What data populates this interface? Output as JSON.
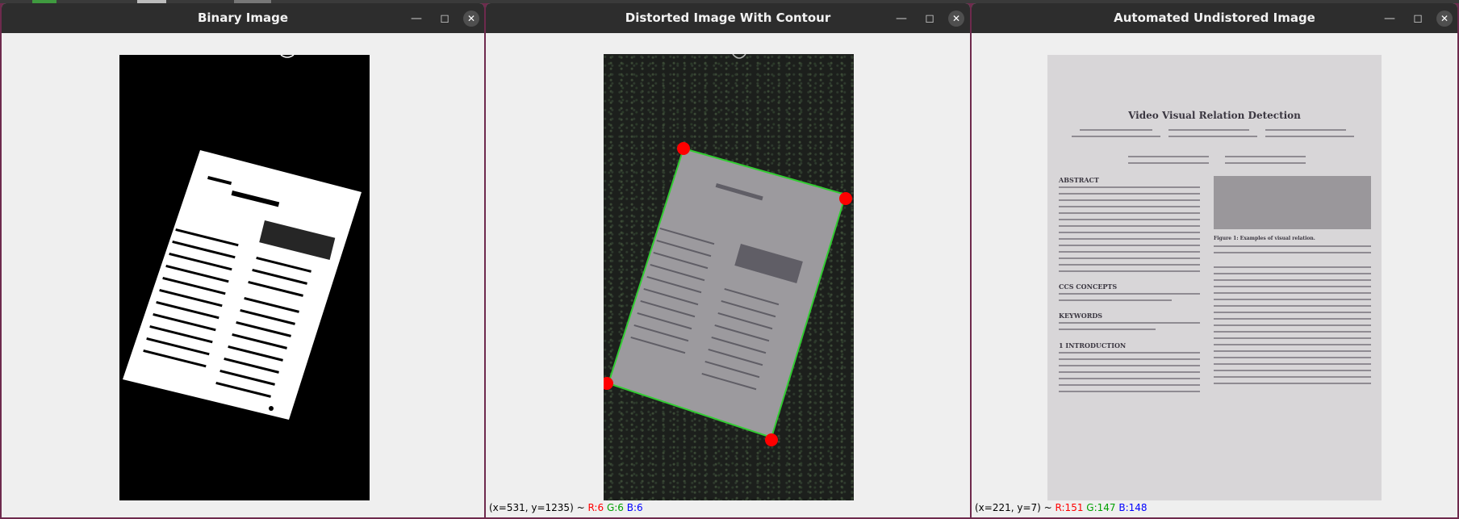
{
  "colors": {
    "desktop": "#6e2a4d",
    "titlebar": "#2d2d2d",
    "window_bg": "#efefef",
    "contour": "#33cc33",
    "corner": "#ff0000",
    "status_r": "#ff0000",
    "status_g": "#00a000",
    "status_b": "#0000ff"
  },
  "icons": [
    "minimize-icon",
    "maximize-icon",
    "close-icon"
  ],
  "windows": [
    {
      "title": "Binary Image",
      "status": null
    },
    {
      "title": "Distorted Image With Contour",
      "status": {
        "coords": "(x=531, y=1235) ~",
        "r": "R:6",
        "g": "G:6",
        "b": "B:6"
      }
    },
    {
      "title": "Automated Undistored Image",
      "status": {
        "coords": "(x=221, y=7) ~",
        "r": "R:151",
        "g": "G:147",
        "b": "B:148"
      }
    }
  ],
  "document": {
    "title": "Video Visual Relation Detection",
    "abstract_heading": "ABSTRACT",
    "ccs_heading": "CCS CONCEPTS",
    "keywords_heading": "KEYWORDS",
    "intro_heading": "1 INTRODUCTION",
    "figure_caption": "Figure 1: Examples of visual relation."
  }
}
